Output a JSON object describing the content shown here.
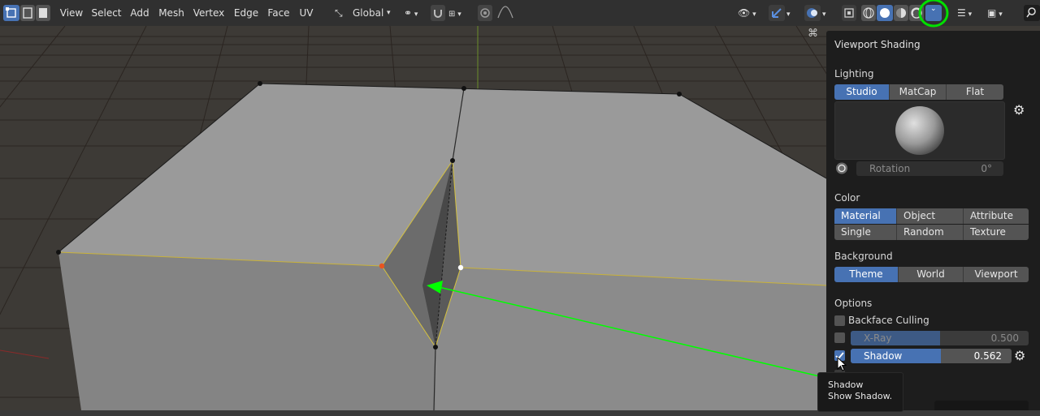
{
  "header": {
    "menus": [
      "View",
      "Select",
      "Add",
      "Mesh",
      "Vertex",
      "Edge",
      "Face",
      "UV"
    ],
    "transform_orientation": "Global"
  },
  "panel": {
    "title": "Viewport Shading",
    "lighting": {
      "label": "Lighting",
      "modes": [
        "Studio",
        "MatCap",
        "Flat"
      ],
      "active": "Studio",
      "rotation_label": "Rotation",
      "rotation_value": "0°"
    },
    "color": {
      "label": "Color",
      "modes": [
        "Material",
        "Object",
        "Attribute",
        "Single",
        "Random",
        "Texture"
      ],
      "active": "Material"
    },
    "background": {
      "label": "Background",
      "modes": [
        "Theme",
        "World",
        "Viewport"
      ],
      "active": "Theme"
    },
    "options": {
      "label": "Options",
      "backface_culling": "Backface Culling",
      "xray_label": "X-Ray",
      "xray_value": "0.500",
      "xray_fraction": 0.5,
      "shadow_label": "Shadow",
      "shadow_value": "0.562",
      "shadow_fraction": 0.562
    }
  },
  "tooltip": {
    "title": "Shadow",
    "description": "Show Shadow."
  },
  "colors": {
    "accent": "#4772b3",
    "header_bg": "#303030",
    "panel_bg": "#1d1d1d",
    "highlight_circle": "#00e000",
    "arrow": "#00ff00"
  }
}
